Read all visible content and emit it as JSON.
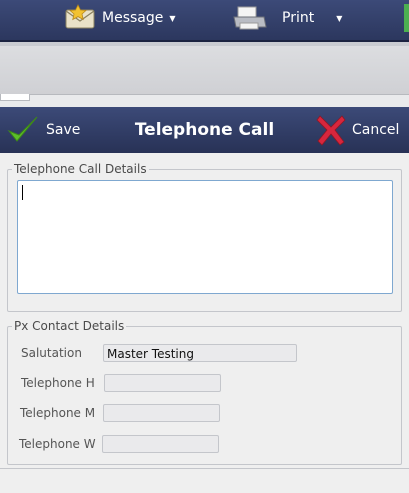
{
  "toolbar": {
    "message_label": "Message",
    "print_label": "Print",
    "message_icon": "envelope-star-icon",
    "print_icon": "printer-icon"
  },
  "dialog": {
    "title": "Telephone Call",
    "save_label": "Save",
    "cancel_label": "Cancel",
    "save_icon": "checkmark-icon",
    "cancel_icon": "cross-icon"
  },
  "call_details": {
    "legend": "Telephone Call Details",
    "notes_value": ""
  },
  "contact": {
    "legend": "Px Contact Details",
    "salutation_label": "Salutation",
    "salutation_value": "Master Testing",
    "tel_h_label": "Telephone H",
    "tel_h_value": "",
    "tel_m_label": "Telephone M",
    "tel_m_value": "",
    "tel_w_label": "Telephone W",
    "tel_w_value": ""
  },
  "colors": {
    "header": "#2f3a63",
    "accent_green": "#5cbf2a",
    "cancel_red": "#d7263d",
    "notes_border": "#7fa8d0"
  }
}
